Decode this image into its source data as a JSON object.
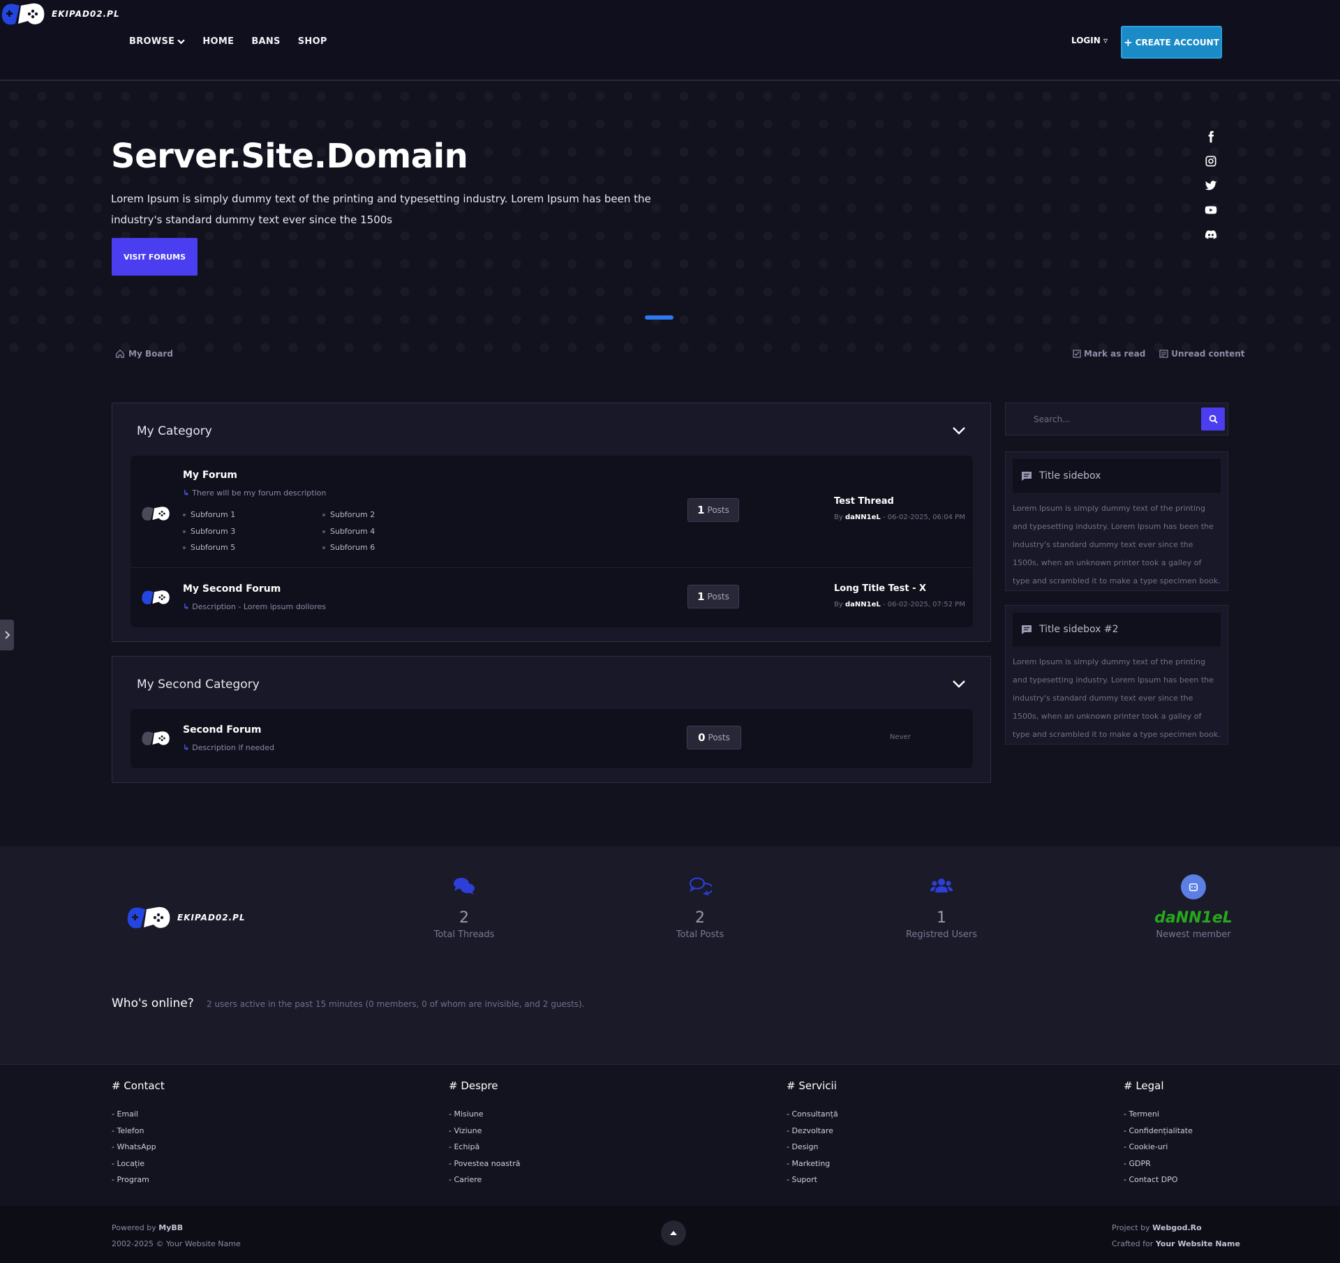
{
  "header": {
    "nav": [
      {
        "label": "BROWSE"
      },
      {
        "label": "HOME"
      },
      {
        "label": "BANS"
      },
      {
        "label": "SHOP"
      }
    ],
    "brand": "EKIPAD02.PL",
    "login_label": "LOGIN",
    "create_account_label": "CREATE ACCOUNT"
  },
  "hero": {
    "title": "Server.Site.Domain",
    "text": "Lorem Ipsum is simply dummy text of the printing and typesetting industry. Lorem Ipsum has been the industry's standard dummy text ever since the 1500s",
    "button_label": "VISIT FORUMS",
    "socials": [
      "facebook-icon",
      "instagram-icon",
      "twitter-icon",
      "youtube-icon",
      "discord-icon"
    ]
  },
  "breadcrumb": {
    "label": "My Board"
  },
  "actions": {
    "mark_read": "Mark as read",
    "unread": "Unread content"
  },
  "categories": [
    {
      "title": "My Category",
      "forums": [
        {
          "name": "My Forum",
          "description": "There will be my forum description",
          "subforums": [
            "Subforum 1",
            "Subforum 2",
            "Subforum 3",
            "Subforum 4",
            "Subforum 5",
            "Subforum 6"
          ],
          "posts_count": "1",
          "posts_label": "Posts",
          "last_title": "Test Thread",
          "last_by": "By",
          "last_user": "daNN1eL",
          "last_date": "- 06-02-2025, 06:04 PM"
        },
        {
          "name": "My Second Forum",
          "description": "Description - Lorem ipsum dollores",
          "posts_count": "1",
          "posts_label": "Posts",
          "last_title": "Long Title Test - X",
          "last_by": "By",
          "last_user": "daNN1eL",
          "last_date": "- 06-02-2025, 07:52 PM"
        }
      ]
    },
    {
      "title": "My Second Category",
      "forums": [
        {
          "name": "Second Forum",
          "description": "Description if needed",
          "posts_count": "0",
          "posts_label": "Posts",
          "last_text": "Never"
        }
      ]
    }
  ],
  "sidebar": {
    "search_placeholder": "Search...",
    "boxes": [
      {
        "title": "Title sidebox",
        "text": "Lorem Ipsum is simply dummy text of the printing and typesetting industry. Lorem Ipsum has been the industry's standard dummy text ever since the 1500s, when an unknown printer took a galley of type and scrambled it to make a type specimen book."
      },
      {
        "title": "Title sidebox #2",
        "text": "Lorem Ipsum is simply dummy text of the printing and typesetting industry. Lorem Ipsum has been the industry's standard dummy text ever since the 1500s, when an unknown printer took a galley of type and scrambled it to make a type specimen book."
      }
    ]
  },
  "stats": {
    "threads": {
      "value": "2",
      "label": "Total Threads"
    },
    "posts": {
      "value": "2",
      "label": "Total Posts"
    },
    "users": {
      "value": "1",
      "label": "Registred Users"
    },
    "newest": {
      "value": "daNN1eL",
      "label": "Newest member"
    }
  },
  "online": {
    "title": "Who's online?",
    "text": "2 users active in the past 15 minutes (0 members, 0 of whom are invisible, and 2 guests)."
  },
  "footer": {
    "columns": [
      {
        "title": "# Contact",
        "items": [
          "- Email",
          "- Telefon",
          "- WhatsApp",
          "- Locație",
          "- Program"
        ]
      },
      {
        "title": "# Despre",
        "items": [
          "- Misiune",
          "- Viziune",
          "- Echipă",
          "- Povestea noastră",
          "- Cariere"
        ]
      },
      {
        "title": "# Servicii",
        "items": [
          "- Consultanță",
          "- Dezvoltare",
          "- Design",
          "- Marketing",
          "- Suport"
        ]
      },
      {
        "title": "# Legal",
        "items": [
          "- Termeni",
          "- Confidențialitate",
          "- Cookie-uri",
          "- GDPR",
          "- Contact DPO"
        ]
      }
    ],
    "powered_prefix": "Powered by",
    "powered_name": "MyBB",
    "copyright": "2002-2025 © Your Website Name",
    "project_prefix": "Project by",
    "project_name": "Webgod.Ro",
    "crafted_prefix": "Crafted for",
    "crafted_name": "Your Website Name"
  },
  "colors": {
    "accent": "#4a3ef0",
    "create": "#1b8bc7",
    "newest": "#26a81c"
  }
}
